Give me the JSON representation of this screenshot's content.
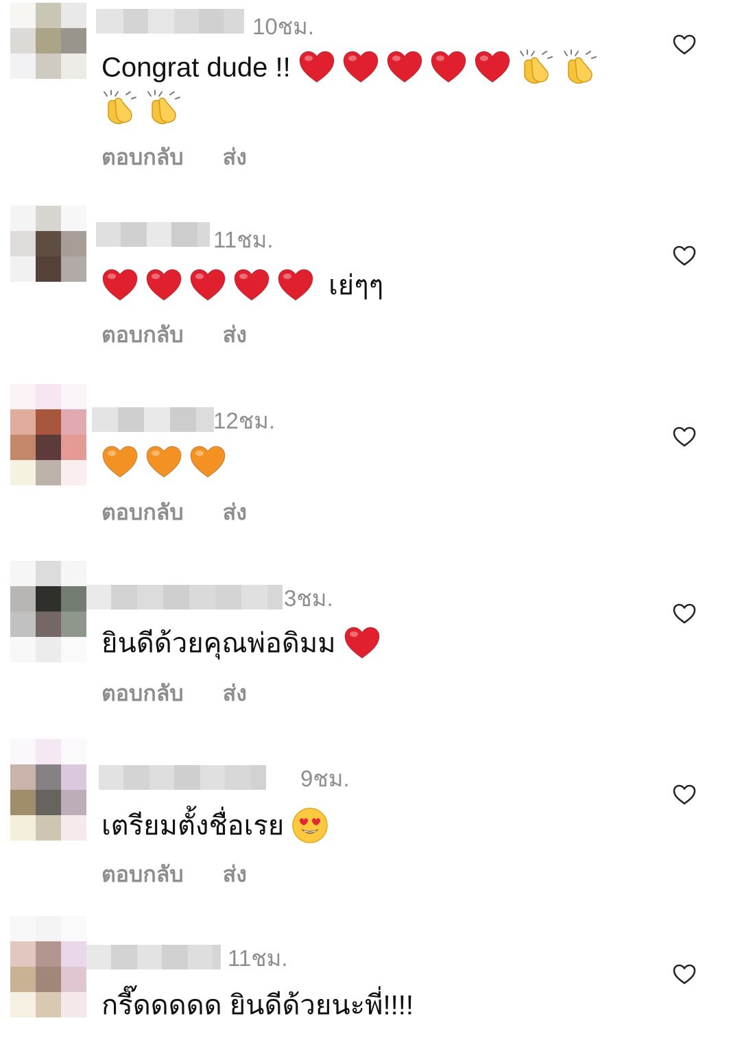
{
  "comments": [
    {
      "time": "10ชม.",
      "text_before": "Congrat dude !!",
      "emojis": [
        "red-heart",
        "red-heart",
        "red-heart",
        "red-heart",
        "red-heart",
        "clap",
        "clap",
        "clap",
        "clap"
      ],
      "text_after": "",
      "reply_label": "ตอบกลับ",
      "send_label": "ส่ง"
    },
    {
      "time": "11ชม.",
      "text_before": "",
      "emojis": [
        "red-heart",
        "red-heart",
        "red-heart",
        "red-heart",
        "red-heart"
      ],
      "text_after": "เย่ๆๆ",
      "reply_label": "ตอบกลับ",
      "send_label": "ส่ง"
    },
    {
      "time": "12ชม.",
      "text_before": "",
      "emojis": [
        "orange-heart",
        "orange-heart",
        "orange-heart"
      ],
      "text_after": "",
      "reply_label": "ตอบกลับ",
      "send_label": "ส่ง"
    },
    {
      "time": "3ชม.",
      "text_before": "ยินดีด้วยคุณพ่อดิมม",
      "emojis": [
        "red-heart"
      ],
      "text_after": "",
      "reply_label": "ตอบกลับ",
      "send_label": "ส่ง"
    },
    {
      "time": "9ชม.",
      "text_before": "เตรียมตั้งชื่อเรย",
      "emojis": [
        "heart-eyes-face"
      ],
      "text_after": "",
      "reply_label": "ตอบกลับ",
      "send_label": "ส่ง"
    },
    {
      "time": "11ชม.",
      "text_before": "กรี๊ดดดดด ยินดีด้วยนะพี่!!!!",
      "emojis": [],
      "text_after": "",
      "reply_label": "",
      "send_label": ""
    }
  ],
  "icons": {
    "like": "heart-outline-icon"
  },
  "colors": {
    "secondary_text": "#8e8e8e",
    "heart_red": "#e0202e",
    "heart_orange": "#f39222"
  }
}
